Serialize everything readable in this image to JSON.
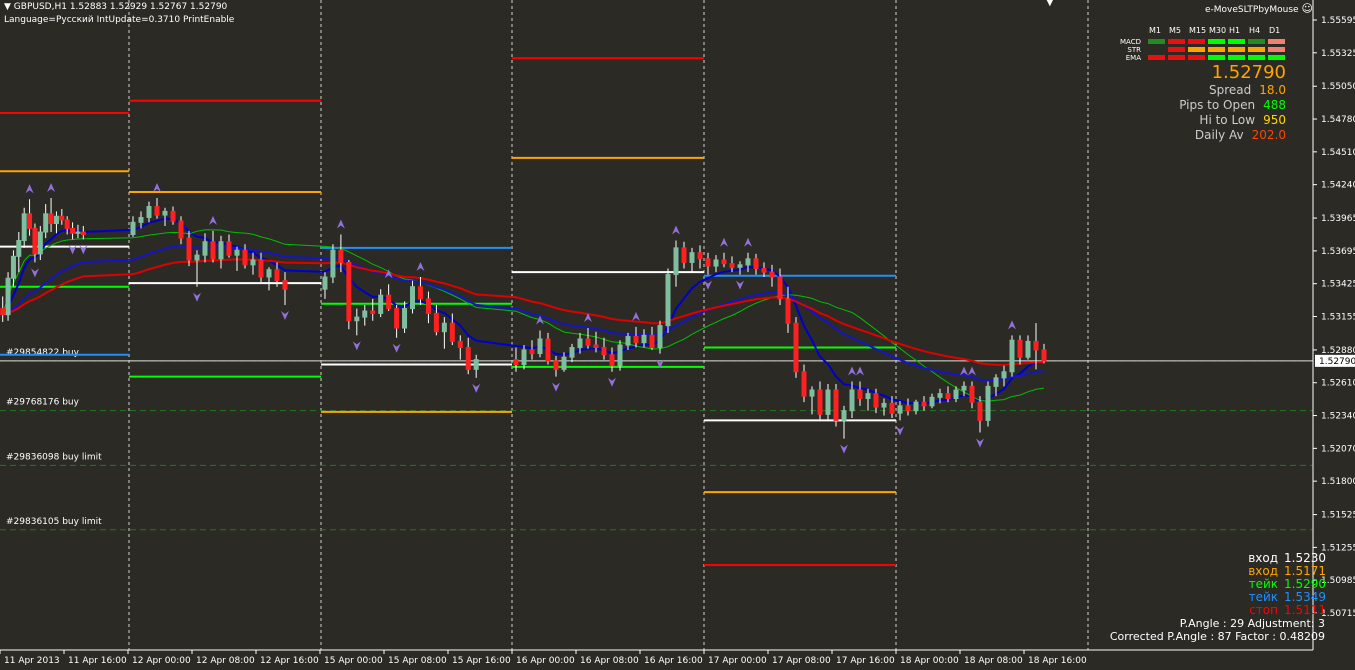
{
  "header": {
    "symbol_line": "GBPUSD,H1  1.52883 1.52929 1.52767 1.52790",
    "info_line": "Language=Русский  IntUpdate=0.3710  PrintEnable",
    "ea_name": "e-MoveSLTPbyMouse"
  },
  "signal_matrix": {
    "timeframes": [
      "M1",
      "M5",
      "M15",
      "M30",
      "H1",
      "H4",
      "D1"
    ],
    "rows": [
      {
        "name": "MACD",
        "colors": [
          "#228b22",
          "#e81010",
          "#e81010",
          "#00ff00",
          "#00ff00",
          "#228b22",
          "#f08070"
        ]
      },
      {
        "name": "STR",
        "colors": [
          "#2b2a25",
          "#e81010",
          "#ffa500",
          "#ffa500",
          "#ffa500",
          "#ffa500",
          "#f08070"
        ]
      },
      {
        "name": "EMA",
        "colors": [
          "#e81010",
          "#e81010",
          "#e81010",
          "#00ff00",
          "#00ff00",
          "#00ff00",
          "#00ff00"
        ]
      }
    ]
  },
  "info_panel": {
    "price": "1.52790",
    "rows": [
      {
        "label": "Spread",
        "value": "18.0",
        "color": "#ffa500"
      },
      {
        "label": "Pips to Open",
        "value": "488",
        "color": "#00ff00"
      },
      {
        "label": "Hi to Low",
        "value": "950",
        "color": "#ffd700"
      },
      {
        "label": "Daily Av",
        "value": "202.0",
        "color": "#ff4500"
      }
    ]
  },
  "levels_panel": [
    {
      "label": "вход",
      "value": "1.5230",
      "color": "#ffffff"
    },
    {
      "label": "вход",
      "value": "1.5171",
      "color": "#ffa500"
    },
    {
      "label": "тейк",
      "value": "1.5290",
      "color": "#00ff00"
    },
    {
      "label": "тейк",
      "value": "1.5349",
      "color": "#1e90ff"
    },
    {
      "label": "стоп",
      "value": "1.5111",
      "color": "#ff0000"
    }
  ],
  "angle_info": {
    "line1": "P.Angle : 29   Adjustment: 3",
    "line2": "Corrected P.Angle : 87   Factor : 0.48209"
  },
  "orders": [
    {
      "label": "#29854822 buy",
      "price": 1.5279,
      "color": "#1e7a1e"
    },
    {
      "label": "#29768176 buy",
      "price": 1.5238,
      "color": "#1e7a1e"
    },
    {
      "label": "#29836098 buy limit",
      "price": 1.5193,
      "color": "#1e7a1e"
    },
    {
      "label": "#29836105 buy limit",
      "price": 1.514,
      "color": "#1e7a1e"
    }
  ],
  "chart_data": {
    "type": "candlestick",
    "symbol": "GBPUSD",
    "timeframe": "H1",
    "ohlc_last": {
      "open": 1.52883,
      "high": 1.52929,
      "low": 1.52767,
      "close": 1.5279
    },
    "current_price": 1.5279,
    "y_ticks": [
      1.55595,
      1.55325,
      1.5505,
      1.5478,
      1.5451,
      1.5424,
      1.53965,
      1.53695,
      1.53425,
      1.53155,
      1.5288,
      1.5261,
      1.5234,
      1.5207,
      1.518,
      1.51525,
      1.51255,
      1.50985,
      1.50715
    ],
    "y_tick_labels": [
      "1.55595",
      "1.55325",
      "1.55050",
      "1.54780",
      "1.54510",
      "1.54240",
      "1.53965",
      "1.53695",
      "1.53425",
      "1.53155",
      "1.52880",
      "1.52610",
      "1.52340",
      "1.52070",
      "1.51800",
      "1.51525",
      "1.51255",
      "1.50985",
      "1.50715"
    ],
    "highlighted_label": "1.52790",
    "x_labels": [
      "11 Apr 2013",
      "11 Apr 16:00",
      "12 Apr 00:00",
      "12 Apr 08:00",
      "12 Apr 16:00",
      "15 Apr 00:00",
      "15 Apr 08:00",
      "15 Apr 16:00",
      "16 Apr 00:00",
      "16 Apr 08:00",
      "16 Apr 16:00",
      "17 Apr 00:00",
      "17 Apr 08:00",
      "17 Apr 16:00",
      "18 Apr 00:00",
      "18 Apr 08:00",
      "18 Apr 16:00"
    ],
    "day_separators": [
      "12 Apr 00:00",
      "15 Apr 00:00",
      "16 Apr 00:00",
      "17 Apr 00:00",
      "18 Apr 00:00"
    ],
    "candles": [
      [
        1.5322,
        1.5332,
        1.5311,
        1.5317
      ],
      [
        1.5317,
        1.5352,
        1.5312,
        1.5347
      ],
      [
        1.5347,
        1.537,
        1.534,
        1.5365
      ],
      [
        1.5365,
        1.5385,
        1.5352,
        1.5378
      ],
      [
        1.5378,
        1.5405,
        1.5372,
        1.54
      ],
      [
        1.54,
        1.5412,
        1.5382,
        1.5388
      ],
      [
        1.5388,
        1.5392,
        1.536,
        1.5367
      ],
      [
        1.5367,
        1.539,
        1.5362,
        1.5385
      ],
      [
        1.5385,
        1.5408,
        1.538,
        1.54
      ],
      [
        1.54,
        1.5413,
        1.5385,
        1.5392
      ],
      [
        1.5392,
        1.5402,
        1.5384,
        1.5398
      ],
      [
        1.5398,
        1.5404,
        1.5391,
        1.5395
      ],
      [
        1.5395,
        1.5398,
        1.5383,
        1.5388
      ],
      [
        1.5388,
        1.5393,
        1.5379,
        1.5384
      ],
      [
        1.5384,
        1.5391,
        1.538,
        1.5385
      ],
      [
        1.5385,
        1.539,
        1.5379,
        1.5383
      ],
      [
        1.5383,
        1.5398,
        1.5381,
        1.5393
      ],
      [
        1.5393,
        1.5402,
        1.5388,
        1.5397
      ],
      [
        1.5397,
        1.541,
        1.5393,
        1.5406
      ],
      [
        1.5406,
        1.5413,
        1.5396,
        1.5399
      ],
      [
        1.5399,
        1.5405,
        1.539,
        1.5402
      ],
      [
        1.5402,
        1.5406,
        1.5391,
        1.5394
      ],
      [
        1.5394,
        1.5398,
        1.5375,
        1.538
      ],
      [
        1.538,
        1.5386,
        1.5357,
        1.5362
      ],
      [
        1.5362,
        1.537,
        1.534,
        1.5366
      ],
      [
        1.5366,
        1.5384,
        1.536,
        1.5377
      ],
      [
        1.5377,
        1.5386,
        1.536,
        1.5363
      ],
      [
        1.5363,
        1.5382,
        1.5355,
        1.5377
      ],
      [
        1.5377,
        1.5383,
        1.5364,
        1.5366
      ],
      [
        1.5366,
        1.5373,
        1.5353,
        1.537
      ],
      [
        1.537,
        1.5375,
        1.5355,
        1.5358
      ],
      [
        1.5358,
        1.5368,
        1.535,
        1.5362
      ],
      [
        1.5362,
        1.5368,
        1.5344,
        1.5348
      ],
      [
        1.5348,
        1.5356,
        1.5337,
        1.5354
      ],
      [
        1.5354,
        1.536,
        1.534,
        1.5345
      ],
      [
        1.5345,
        1.5352,
        1.5325,
        1.5338
      ],
      [
        1.5338,
        1.5352,
        1.533,
        1.5348
      ],
      [
        1.5348,
        1.5375,
        1.5343,
        1.537
      ],
      [
        1.537,
        1.5383,
        1.5352,
        1.536
      ],
      [
        1.536,
        1.5362,
        1.5305,
        1.5312
      ],
      [
        1.5312,
        1.5322,
        1.53,
        1.5315
      ],
      [
        1.5315,
        1.5325,
        1.5308,
        1.532
      ],
      [
        1.532,
        1.533,
        1.5312,
        1.5318
      ],
      [
        1.5318,
        1.5338,
        1.5315,
        1.5333
      ],
      [
        1.5333,
        1.5342,
        1.532,
        1.5322
      ],
      [
        1.5322,
        1.5325,
        1.5298,
        1.5306
      ],
      [
        1.5306,
        1.5328,
        1.5302,
        1.5322
      ],
      [
        1.5322,
        1.5345,
        1.5318,
        1.534
      ],
      [
        1.534,
        1.5348,
        1.5325,
        1.533
      ],
      [
        1.533,
        1.5336,
        1.531,
        1.5318
      ],
      [
        1.5318,
        1.5325,
        1.53,
        1.5303
      ],
      [
        1.5303,
        1.5315,
        1.5289,
        1.531
      ],
      [
        1.531,
        1.5318,
        1.5292,
        1.5295
      ],
      [
        1.5295,
        1.53,
        1.528,
        1.529
      ],
      [
        1.529,
        1.5298,
        1.5268,
        1.5272
      ],
      [
        1.5272,
        1.5284,
        1.5265,
        1.528
      ],
      [
        1.528,
        1.529,
        1.527,
        1.5276
      ],
      [
        1.5276,
        1.5292,
        1.5272,
        1.5288
      ],
      [
        1.5288,
        1.5296,
        1.528,
        1.5285
      ],
      [
        1.5285,
        1.5304,
        1.5282,
        1.5297
      ],
      [
        1.5297,
        1.5302,
        1.5276,
        1.5279
      ],
      [
        1.5279,
        1.5283,
        1.5266,
        1.5272
      ],
      [
        1.5272,
        1.5286,
        1.527,
        1.5282
      ],
      [
        1.5282,
        1.5293,
        1.5278,
        1.529
      ],
      [
        1.529,
        1.5302,
        1.5285,
        1.5297
      ],
      [
        1.5297,
        1.5306,
        1.5289,
        1.5292
      ],
      [
        1.5292,
        1.5303,
        1.5286,
        1.529
      ],
      [
        1.529,
        1.5298,
        1.528,
        1.5284
      ],
      [
        1.5284,
        1.529,
        1.527,
        1.5275
      ],
      [
        1.5275,
        1.5296,
        1.5271,
        1.5292
      ],
      [
        1.5292,
        1.5302,
        1.5288,
        1.5299
      ],
      [
        1.5299,
        1.5307,
        1.529,
        1.5294
      ],
      [
        1.5294,
        1.5305,
        1.529,
        1.53
      ],
      [
        1.53,
        1.5307,
        1.5288,
        1.529
      ],
      [
        1.529,
        1.5312,
        1.5285,
        1.5308
      ],
      [
        1.5308,
        1.5355,
        1.5302,
        1.535
      ],
      [
        1.535,
        1.5378,
        1.534,
        1.5372
      ],
      [
        1.5372,
        1.5377,
        1.5355,
        1.536
      ],
      [
        1.536,
        1.5372,
        1.5352,
        1.5368
      ],
      [
        1.5368,
        1.5374,
        1.5355,
        1.5363
      ],
      [
        1.5363,
        1.5368,
        1.535,
        1.5357
      ],
      [
        1.5357,
        1.5366,
        1.5352,
        1.5362
      ],
      [
        1.5362,
        1.5368,
        1.5356,
        1.5359
      ],
      [
        1.5359,
        1.5365,
        1.5352,
        1.5356
      ],
      [
        1.5356,
        1.5361,
        1.535,
        1.5358
      ],
      [
        1.5358,
        1.5368,
        1.5352,
        1.5363
      ],
      [
        1.5363,
        1.5367,
        1.535,
        1.5355
      ],
      [
        1.5355,
        1.536,
        1.5348,
        1.5352
      ],
      [
        1.5352,
        1.5358,
        1.534,
        1.5348
      ],
      [
        1.5348,
        1.5355,
        1.5325,
        1.533
      ],
      [
        1.533,
        1.534,
        1.5302,
        1.531
      ],
      [
        1.531,
        1.5315,
        1.5265,
        1.527
      ],
      [
        1.527,
        1.5276,
        1.5245,
        1.525
      ],
      [
        1.525,
        1.5258,
        1.5235,
        1.5255
      ],
      [
        1.5255,
        1.5262,
        1.523,
        1.5235
      ],
      [
        1.5235,
        1.526,
        1.523,
        1.5255
      ],
      [
        1.5255,
        1.526,
        1.5225,
        1.523
      ],
      [
        1.523,
        1.5242,
        1.5215,
        1.5238
      ],
      [
        1.5238,
        1.5262,
        1.5232,
        1.5255
      ],
      [
        1.5255,
        1.5262,
        1.5242,
        1.5248
      ],
      [
        1.5248,
        1.5256,
        1.5238,
        1.5252
      ],
      [
        1.5252,
        1.5256,
        1.5236,
        1.5241
      ],
      [
        1.5241,
        1.5248,
        1.5234,
        1.5244
      ],
      [
        1.5244,
        1.525,
        1.5232,
        1.5236
      ],
      [
        1.5236,
        1.5246,
        1.523,
        1.5242
      ],
      [
        1.5242,
        1.5248,
        1.5234,
        1.5238
      ],
      [
        1.5238,
        1.5247,
        1.5235,
        1.5245
      ],
      [
        1.5245,
        1.525,
        1.5238,
        1.5242
      ],
      [
        1.5242,
        1.5252,
        1.524,
        1.5249
      ],
      [
        1.5249,
        1.5256,
        1.5244,
        1.5252
      ],
      [
        1.5252,
        1.5258,
        1.5245,
        1.5248
      ],
      [
        1.5248,
        1.5258,
        1.5245,
        1.5255
      ],
      [
        1.5255,
        1.5262,
        1.525,
        1.5258
      ],
      [
        1.5258,
        1.5262,
        1.524,
        1.5245
      ],
      [
        1.5245,
        1.525,
        1.522,
        1.523
      ],
      [
        1.523,
        1.5262,
        1.5225,
        1.5258
      ],
      [
        1.5258,
        1.5268,
        1.525,
        1.5265
      ],
      [
        1.5265,
        1.5275,
        1.5258,
        1.527
      ],
      [
        1.527,
        1.53,
        1.5266,
        1.5296
      ],
      [
        1.5296,
        1.53,
        1.5276,
        1.5282
      ],
      [
        1.5282,
        1.53,
        1.528,
        1.5295
      ],
      [
        1.5295,
        1.531,
        1.5272,
        1.5288
      ],
      [
        1.5288,
        1.5293,
        1.5277,
        1.5279
      ]
    ],
    "h_levels": [
      {
        "name": "entry-white",
        "color": "#ffffff",
        "price": [
          [
            1.5373
          ],
          [
            1.5343
          ],
          [
            1.5276
          ],
          [
            1.5352
          ],
          [
            1.523
          ]
        ]
      },
      {
        "name": "take-green",
        "color": "#00ff00",
        "price": [
          [
            1.534
          ],
          [
            1.5266
          ],
          [
            1.5326
          ],
          [
            1.5274
          ],
          [
            1.529
          ]
        ]
      },
      {
        "name": "stop-red",
        "color": "#ff0000",
        "price": [
          [
            1.5483
          ],
          [
            1.5493
          ],
          [
            null
          ],
          [
            1.5528
          ],
          [
            1.5111
          ]
        ]
      },
      {
        "name": "entry-orange",
        "color": "#ffa500",
        "price": [
          [
            1.5435
          ],
          [
            1.5418
          ],
          [
            1.5237
          ],
          [
            1.5446
          ],
          [
            1.5171
          ]
        ]
      },
      {
        "name": "take-blue",
        "color": "#1e90ff",
        "price": [
          [
            1.5284
          ],
          [
            null
          ],
          [
            1.5372
          ],
          [
            null
          ],
          [
            1.5349
          ]
        ]
      }
    ]
  }
}
